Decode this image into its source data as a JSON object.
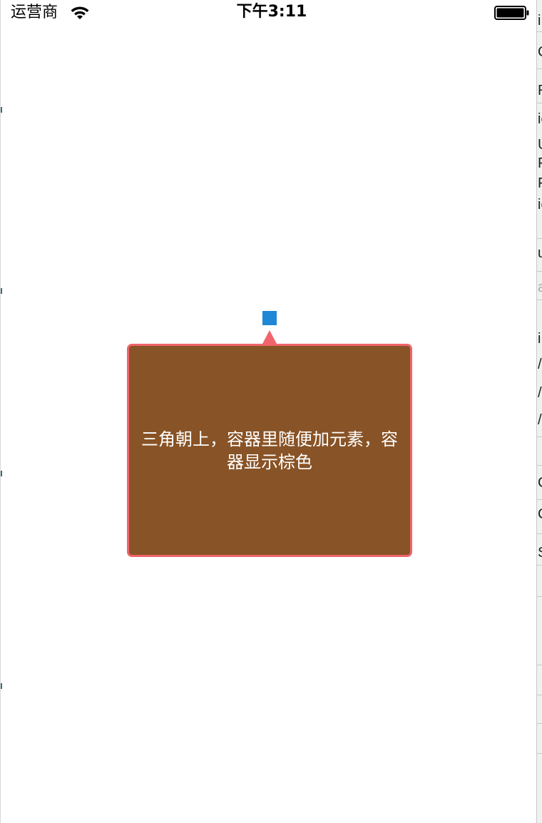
{
  "status_bar": {
    "carrier": "运营商",
    "time": "下午3:11",
    "wifi_icon": "wifi-icon",
    "battery_icon": "battery-icon"
  },
  "popover": {
    "text": "三角朝上，容器里随便加元素，容器显示棕色",
    "anchor_color": "#1e87d6",
    "arrow_color": "#f0646b",
    "border_color": "#f0646b",
    "background_color": "#885326"
  },
  "side_strip": {
    "glyphs": [
      "i",
      "C",
      "R",
      "ie",
      "U",
      "F",
      "F",
      "ie",
      "u",
      "a",
      "i",
      "/",
      "/",
      "/",
      "C",
      "C",
      "S"
    ]
  }
}
